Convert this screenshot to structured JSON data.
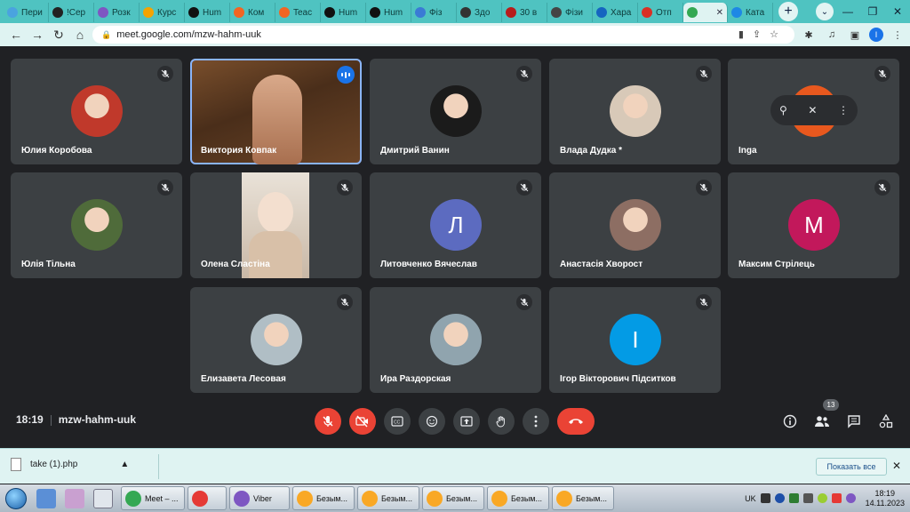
{
  "browser": {
    "tabs": [
      {
        "label": "Пери",
        "color": "#4aa3df"
      },
      {
        "label": "!Сер",
        "color": "#222222"
      },
      {
        "label": "Розк",
        "color": "#7e57c2"
      },
      {
        "label": "Курс",
        "color": "#f4a300"
      },
      {
        "label": "Hum",
        "color": "#111111"
      },
      {
        "label": "Ком",
        "color": "#f26522"
      },
      {
        "label": "Teac",
        "color": "#f26522"
      },
      {
        "label": "Hum",
        "color": "#111111"
      },
      {
        "label": "Hum",
        "color": "#111111"
      },
      {
        "label": "Фіз",
        "color": "#3a7bd5"
      },
      {
        "label": "Здо",
        "color": "#333333"
      },
      {
        "label": "30 в",
        "color": "#b71c1c"
      },
      {
        "label": "Фізи",
        "color": "#444444"
      },
      {
        "label": "Хара",
        "color": "#1565c0"
      },
      {
        "label": "Отп",
        "color": "#d93025"
      },
      {
        "label": "",
        "color": "#34a853",
        "active": true
      },
      {
        "label": "Ката",
        "color": "#1e88e5"
      }
    ],
    "active_tab_close": "✕",
    "new_tab": "+",
    "url": "meet.google.com/mzw-hahm-uuk",
    "profile_initial": "I"
  },
  "meet": {
    "participants": [
      {
        "name": "Юлия Коробова",
        "type": "photo",
        "color": "#c0392b"
      },
      {
        "name": "Виктория Ковпак",
        "type": "video"
      },
      {
        "name": "Дмитрий Ванин",
        "type": "photo",
        "color": "#1b1b1b"
      },
      {
        "name": "Влада Дудка *",
        "type": "photo",
        "color": "#d8c9b8"
      },
      {
        "name": "Inga",
        "type": "hover"
      },
      {
        "name": "Юлія Тільна",
        "type": "photo",
        "color": "#4f6b3a"
      },
      {
        "name": "Олена Сластіна",
        "type": "video2"
      },
      {
        "name": "Литовченко Вячеслав",
        "type": "letter",
        "letter": "Л",
        "color": "#5c6bc0"
      },
      {
        "name": "Анастасія Хворост",
        "type": "photo",
        "color": "#8d6e63"
      },
      {
        "name": "Максим Стрілець",
        "type": "letter",
        "letter": "М",
        "color": "#c2185b"
      },
      {
        "name": "Елизавета Лесовая",
        "type": "photo",
        "color": "#b0bec5"
      },
      {
        "name": "Ира Раздорская",
        "type": "photo",
        "color": "#90a4ae"
      },
      {
        "name": "Ігор Вікторович Підситков",
        "type": "letter",
        "letter": "І",
        "color": "#039be5"
      }
    ],
    "time": "18:19",
    "meeting_code": "mzw-hahm-uuk",
    "participant_count": "13"
  },
  "downloads": {
    "file": "take (1).php",
    "show_all": "Показать все"
  },
  "taskbar": {
    "buttons": [
      {
        "label": "Meet – ...",
        "color": "#34a853"
      },
      {
        "label": "",
        "color": "#e53935"
      },
      {
        "label": "Viber",
        "color": "#7e57c2"
      },
      {
        "label": "Безым...",
        "color": "#f9a825"
      },
      {
        "label": "Безым...",
        "color": "#f9a825"
      },
      {
        "label": "Безым...",
        "color": "#f9a825"
      },
      {
        "label": "Безым...",
        "color": "#f9a825"
      },
      {
        "label": "Безым...",
        "color": "#f9a825"
      }
    ],
    "lang": "UK",
    "clock_time": "18:19",
    "clock_date": "14.11.2023"
  },
  "colors": {
    "meet_bg": "#202124",
    "tile_bg": "#3c4043",
    "danger": "#ea4335",
    "accent": "#1a73e8"
  }
}
